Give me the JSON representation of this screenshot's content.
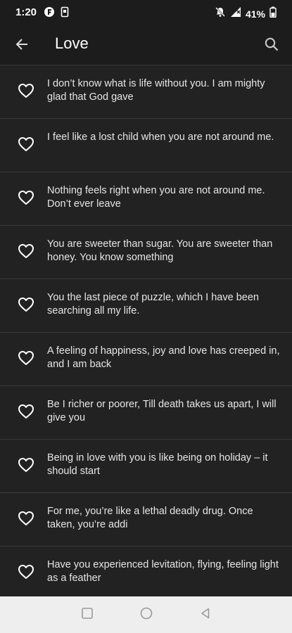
{
  "status_bar": {
    "time": "1:20",
    "battery": "41%"
  },
  "app_bar": {
    "title": "Love"
  },
  "quotes": [
    "I don’t know what is life without you. I am mighty glad that God gave",
    "I feel like a lost child when you are not around me.",
    "Nothing feels right when you are not around me. Don’t ever leave",
    "You are sweeter than sugar. You are sweeter than honey. You know something",
    "You the last piece of puzzle, which I have been searching all my life.",
    "A feeling of happiness, joy and love has creeped in, and I am back",
    "Be I richer or poorer, Till death takes us apart, I will give you",
    "Being in love with you is like being on holiday – it should start",
    "For me, you’re like a lethal deadly drug. Once taken, you’re addi",
    "Have you experienced levitation, flying, feeling light as a feather"
  ],
  "icons": {
    "back": "arrow-left-icon",
    "search": "search-icon",
    "favorite": "heart-outline-icon",
    "nav_recents": "square-icon",
    "nav_home": "circle-icon",
    "nav_back": "triangle-back-icon"
  },
  "colors": {
    "background": "#1c1c1c",
    "list_item": "#222222",
    "divider": "#3a3a3a",
    "text": "#e6e6e6",
    "nav_bar": "#eeeeee"
  }
}
